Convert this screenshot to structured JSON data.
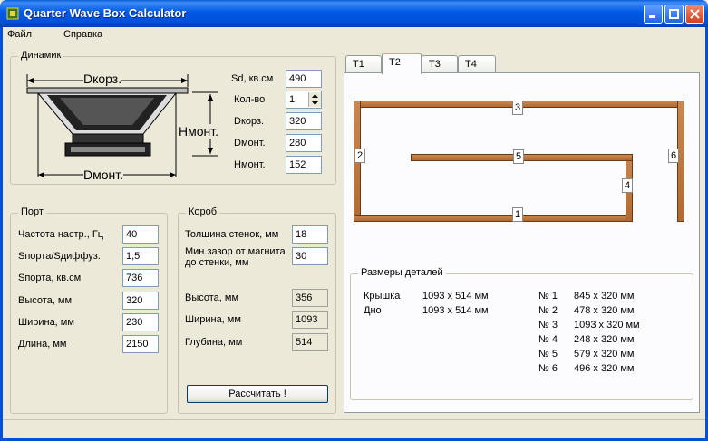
{
  "window": {
    "title": "Quarter Wave Box Calculator"
  },
  "menu": [
    "Файл",
    "Справка"
  ],
  "speaker": {
    "legend": "Динамик",
    "diagram_labels": {
      "dkorz": "Dкорз.",
      "dmont": "Dмонт.",
      "hmont": "Нмонт."
    },
    "fields": [
      {
        "label": "Sd, кв.см",
        "value": "490"
      },
      {
        "label": "Кол-во",
        "value": "1"
      },
      {
        "label": "Dкорз.",
        "value": "320"
      },
      {
        "label": "Dмонт.",
        "value": "280"
      },
      {
        "label": "Нмонт.",
        "value": "152"
      }
    ]
  },
  "port": {
    "legend": "Порт",
    "fields": [
      {
        "label": "Частота настр., Гц",
        "value": "40"
      },
      {
        "label": "Sпорта/Sдиффуз.",
        "value": "1,5"
      },
      {
        "label": "Sпорта, кв.см",
        "value": "736"
      },
      {
        "label": "Высота, мм",
        "value": "320"
      },
      {
        "label": "Ширина, мм",
        "value": "230"
      },
      {
        "label": "Длина, мм",
        "value": "2150"
      }
    ]
  },
  "box": {
    "legend": "Короб",
    "inputs": [
      {
        "label": "Толщина стенок, мм",
        "value": "18"
      },
      {
        "label_line1": "Мин.зазор от магнита",
        "label_line2": "до стенки, мм",
        "value": "30"
      }
    ],
    "outputs": [
      {
        "label": "Высота, мм",
        "value": "356"
      },
      {
        "label": "Ширина, мм",
        "value": "1093"
      },
      {
        "label": "Глубина, мм",
        "value": "514"
      }
    ],
    "calc_button": "Рассчитать !"
  },
  "tabs": [
    "T1",
    "T2",
    "T3",
    "T4"
  ],
  "active_tab": "T2",
  "drawing_labels": [
    "3",
    "2",
    "5",
    "6",
    "4",
    "1"
  ],
  "details": {
    "legend": "Размеры деталей",
    "left": [
      {
        "name": "Крышка",
        "size": "1093 x 514 мм"
      },
      {
        "name": "Дно",
        "size": "1093 x 514 мм"
      }
    ],
    "right": [
      {
        "num": "№ 1",
        "size": "845 x 320 мм"
      },
      {
        "num": "№ 2",
        "size": "478 x 320 мм"
      },
      {
        "num": "№ 3",
        "size": "1093 x 320 мм"
      },
      {
        "num": "№ 4",
        "size": "248 x 320 мм"
      },
      {
        "num": "№ 5",
        "size": "579 x 320 мм"
      },
      {
        "num": "№ 6",
        "size": "496 x 320 мм"
      }
    ]
  },
  "colors": {
    "titlebar": "#0058e6",
    "wood": "#c07a40",
    "window_bg": "#ece9d8"
  }
}
